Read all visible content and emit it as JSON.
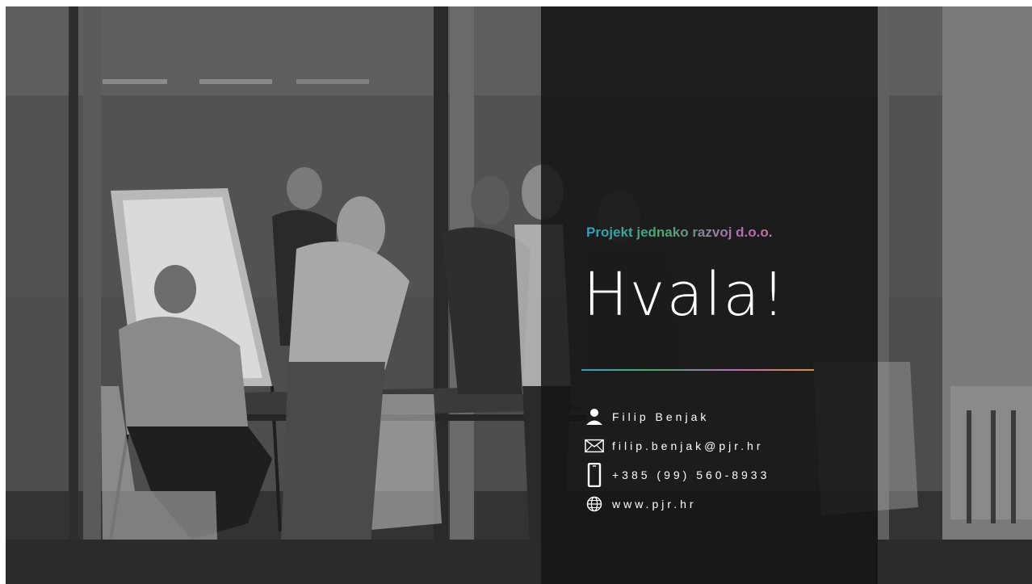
{
  "slide": {
    "company": "Projekt jednako razvoj d.o.o.",
    "title": "Hvala!",
    "contacts": [
      {
        "icon": "person-icon",
        "text": "Filip Benjak"
      },
      {
        "icon": "envelope-icon",
        "text": "filip.benjak@pjr.hr"
      },
      {
        "icon": "mobile-phone-icon",
        "text": "+385 (99) 560-8933"
      },
      {
        "icon": "globe-icon",
        "text": "www.pjr.hr"
      }
    ]
  },
  "colors": {
    "gradient": [
      "#2f9fc4",
      "#4aa86f",
      "#b86ab8",
      "#e08a46"
    ],
    "panel": "#141414",
    "text": "#ffffff"
  }
}
